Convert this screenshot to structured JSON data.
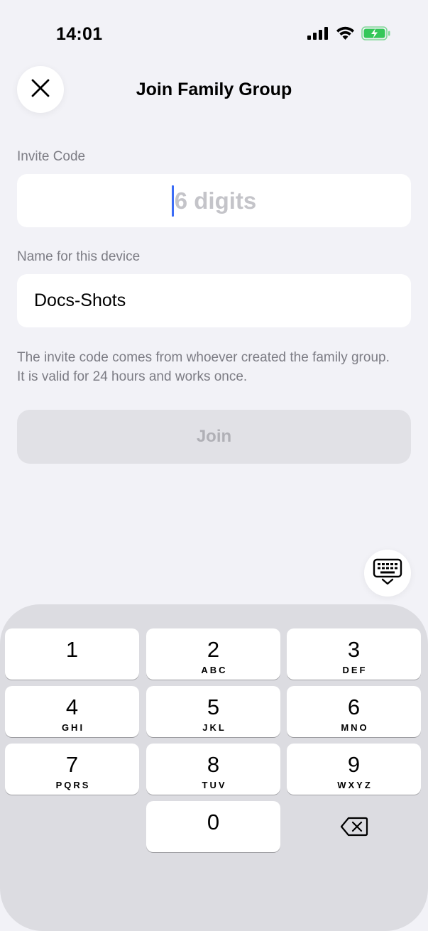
{
  "status_bar": {
    "time": "14:01",
    "signal_icon": "cellular-signal-icon",
    "wifi_icon": "wifi-icon",
    "battery_icon": "battery-charging-icon",
    "battery_color": "#34c759"
  },
  "header": {
    "close_icon": "close-icon",
    "title": "Join Family Group"
  },
  "form": {
    "invite_code": {
      "label": "Invite Code",
      "value": "",
      "placeholder": "6 digits"
    },
    "device_name": {
      "label": "Name for this device",
      "value": "Docs-Shots"
    },
    "helper_text": "The invite code comes from whoever created the family group. It is valid for 24 hours and works once.",
    "join_button": "Join",
    "join_enabled": false
  },
  "keyboard_toggle_icon": "keyboard-dismiss-icon",
  "keypad": {
    "keys": [
      {
        "digit": "1",
        "letters": ""
      },
      {
        "digit": "2",
        "letters": "ABC"
      },
      {
        "digit": "3",
        "letters": "DEF"
      },
      {
        "digit": "4",
        "letters": "GHI"
      },
      {
        "digit": "5",
        "letters": "JKL"
      },
      {
        "digit": "6",
        "letters": "MNO"
      },
      {
        "digit": "7",
        "letters": "PQRS"
      },
      {
        "digit": "8",
        "letters": "TUV"
      },
      {
        "digit": "9",
        "letters": "WXYZ"
      },
      {
        "digit": "0",
        "letters": ""
      }
    ],
    "delete_icon": "backspace-icon"
  },
  "colors": {
    "background": "#f2f2f7",
    "accent_cursor": "#3b6cf6",
    "keypad_background": "#dcdce1"
  }
}
